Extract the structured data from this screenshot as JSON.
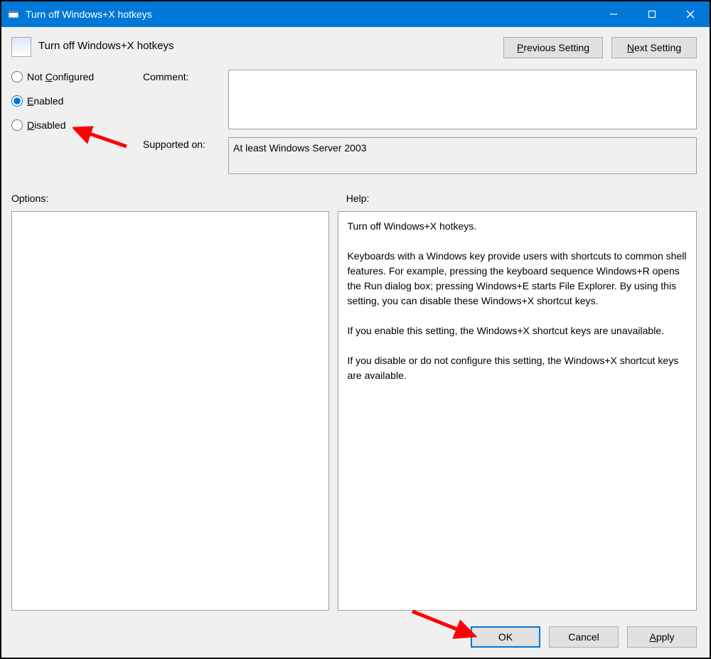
{
  "titlebar": {
    "title": "Turn off Windows+X hotkeys"
  },
  "page_title": "Turn off Windows+X hotkeys",
  "nav": {
    "prev_label": "Previous Setting",
    "next_label": "Next Setting"
  },
  "state": {
    "options": [
      "Not Configured",
      "Enabled",
      "Disabled"
    ],
    "not_configured": "Not Configured",
    "enabled": "Enabled",
    "disabled": "Disabled",
    "selected": "Enabled"
  },
  "labels": {
    "comment": "Comment:",
    "supported_on": "Supported on:",
    "options": "Options:",
    "help": "Help:"
  },
  "fields": {
    "comment_value": "",
    "supported_on_value": "At least Windows Server 2003"
  },
  "help_text": "Turn off Windows+X hotkeys.\n\nKeyboards with a Windows key provide users with shortcuts to common shell features. For example, pressing the keyboard sequence Windows+R opens the Run dialog box; pressing Windows+E starts File Explorer. By using this setting, you can disable these Windows+X shortcut keys.\n\nIf you enable this setting, the Windows+X shortcut keys are unavailable.\n\nIf you disable or do not configure this setting, the Windows+X shortcut keys are available.",
  "options_text": "",
  "footer": {
    "ok": "OK",
    "cancel": "Cancel",
    "apply": "Apply"
  }
}
